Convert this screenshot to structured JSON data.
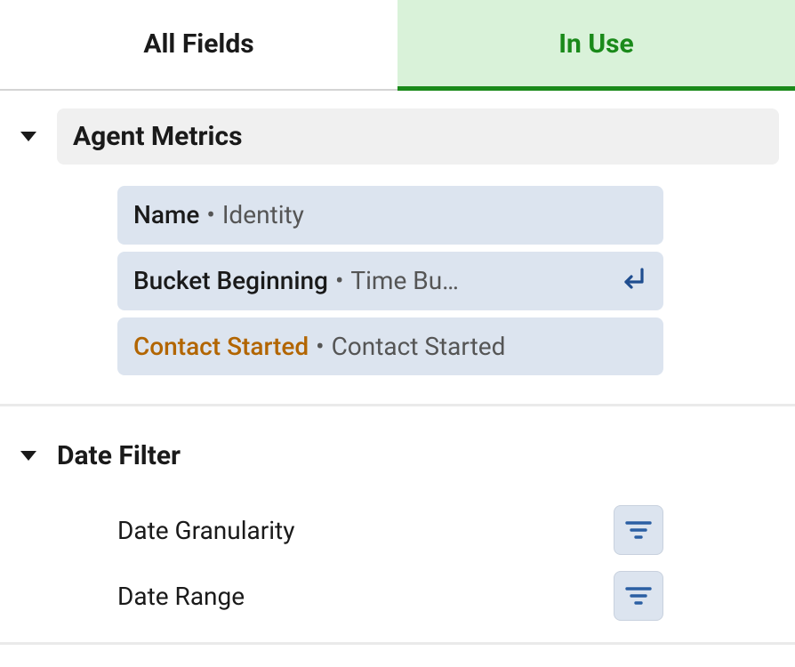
{
  "tabs": {
    "all_fields_label": "All Fields",
    "in_use_label": "In Use",
    "active": "in_use"
  },
  "sections": {
    "agent_metrics": {
      "title": "Agent Metrics",
      "items": [
        {
          "primary": "Name",
          "secondary": "Identity",
          "highlight": false,
          "has_icon": false
        },
        {
          "primary": "Bucket Beginning",
          "secondary": "Time Bu…",
          "highlight": false,
          "has_icon": true,
          "icon": "return-icon"
        },
        {
          "primary": "Contact Started",
          "secondary": "Contact Started",
          "highlight": true,
          "has_icon": false
        }
      ]
    },
    "date_filter": {
      "title": "Date Filter",
      "items": [
        {
          "label": "Date Granularity"
        },
        {
          "label": "Date Range"
        }
      ]
    }
  }
}
